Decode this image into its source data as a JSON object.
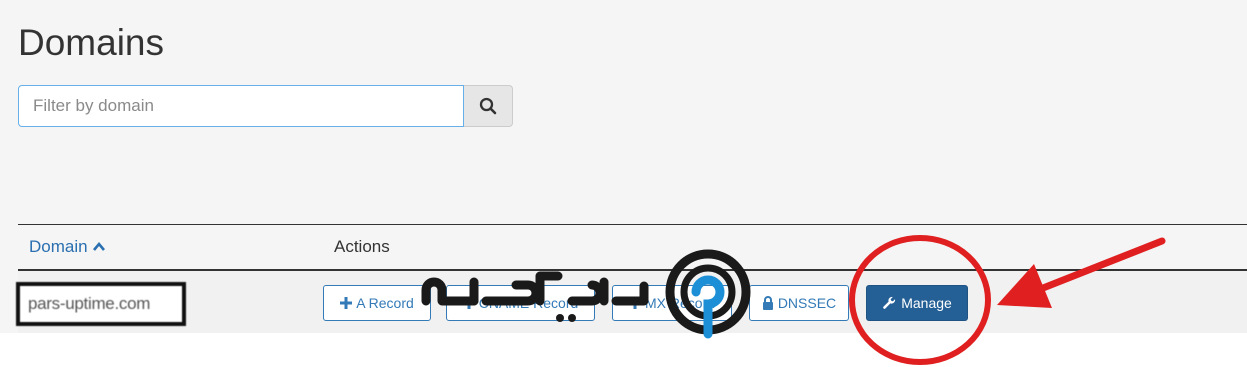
{
  "page": {
    "title": "Domains"
  },
  "search": {
    "placeholder": "Filter by domain",
    "value": ""
  },
  "icons": {
    "search": "search-icon",
    "sort": "chevron-up-icon",
    "plus": "plus-icon",
    "lock": "lock-icon",
    "wrench": "wrench-icon"
  },
  "table": {
    "headers": {
      "domain": "Domain",
      "actions": "Actions"
    },
    "rows": [
      {
        "domain": "pars-uptime.com",
        "actions": {
          "a_record": "A Record",
          "cname_record": "CNAME Record",
          "mx_record": "MX Record",
          "dnssec": "DNSSEC",
          "manage": "Manage"
        }
      }
    ]
  },
  "colors": {
    "link": "#337ab7",
    "primary_button": "#245f96",
    "annotation": "#e02020",
    "focus_border": "#66afe9"
  },
  "watermark": {
    "text": "پارس آپتایم"
  }
}
